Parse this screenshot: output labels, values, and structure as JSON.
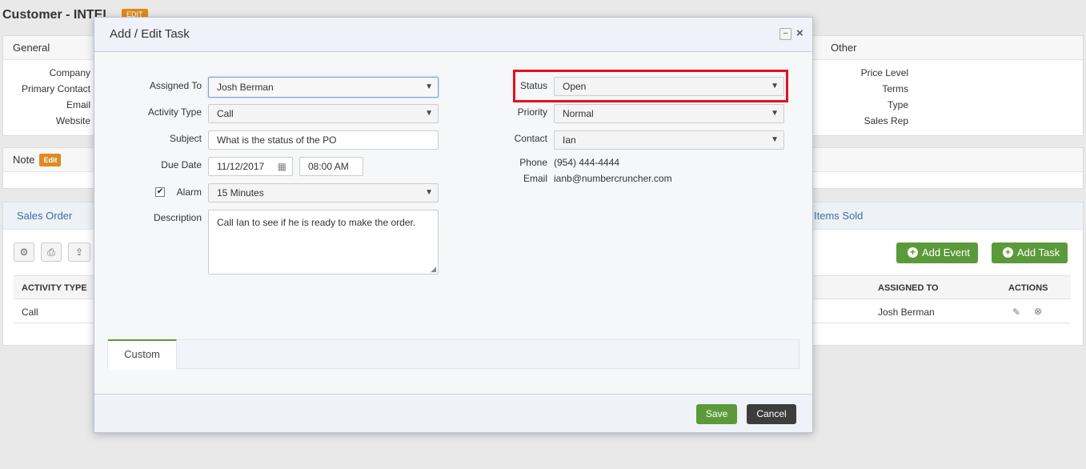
{
  "page": {
    "title": "Customer - INTEL",
    "title_badge": "EDIT"
  },
  "general": {
    "heading": "General",
    "labels": [
      "Company",
      "Primary Contact",
      "Email",
      "Website"
    ]
  },
  "other": {
    "heading": "Other",
    "labels": [
      "Price Level",
      "Terms",
      "Type",
      "Sales Rep"
    ]
  },
  "note": {
    "heading": "Note",
    "edit_label": "Edit"
  },
  "tabs_bg": {
    "sales_order": "Sales Order",
    "items_sold": "Items Sold"
  },
  "toolbar": {
    "settings_icon": "gear-icon",
    "print_icon": "print-icon",
    "export_icon": "export-icon"
  },
  "actions": {
    "add_event": "Add Event",
    "add_task": "Add Task"
  },
  "activity_table": {
    "columns": [
      "ACTIVITY TYPE",
      "ASSIGNED TO",
      "ACTIONS"
    ],
    "rows": [
      {
        "activity_type": "Call",
        "assigned_to": "Josh Berman"
      }
    ]
  },
  "modal": {
    "title": "Add / Edit Task",
    "minimize": "–",
    "close": "×",
    "form": {
      "assigned_to_label": "Assigned To",
      "assigned_to_value": "Josh Berman",
      "activity_type_label": "Activity Type",
      "activity_type_value": "Call",
      "subject_label": "Subject",
      "subject_value": "What is the status of the PO",
      "due_date_label": "Due Date",
      "due_date_value": "11/12/2017",
      "due_time_value": "08:00 AM",
      "alarm_label": "Alarm",
      "alarm_checked": true,
      "alarm_value": "15 Minutes",
      "description_label": "Description",
      "description_value": "Call Ian to see if he is ready to make the order.",
      "status_label": "Status",
      "status_value": "Open",
      "priority_label": "Priority",
      "priority_value": "Normal",
      "contact_label": "Contact",
      "contact_value": "Ian",
      "phone_label": "Phone",
      "phone_value": "(954) 444-4444",
      "email_label": "Email",
      "email_value": "ianb@numbercruncher.com"
    },
    "tab_custom": "Custom",
    "save_label": "Save",
    "cancel_label": "Cancel"
  },
  "colors": {
    "green": "#5b9a3a",
    "orange_badge": "#e08a1e",
    "highlight_red": "#e3111b",
    "dark_button": "#3d3d3d"
  }
}
